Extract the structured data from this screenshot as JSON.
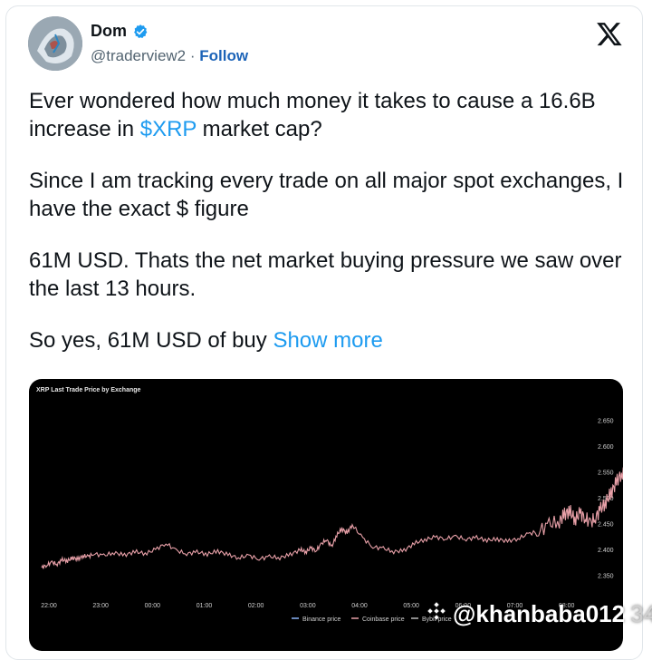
{
  "author": {
    "name": "Dom",
    "handle": "@traderview2",
    "separator": "·",
    "follow_label": "Follow",
    "verified_color": "#1d9bf0"
  },
  "x_logo": "x-logo",
  "tweet": {
    "p1_before": "Ever wondered how much money it takes to cause a 16.6B increase in ",
    "cashtag": "$XRP",
    "p1_after": " market cap?",
    "p2": "Since I am tracking every trade on all major spot exchanges, I have the exact $ figure",
    "p3": "61M USD. Thats the net market buying pressure we saw over the last 13 hours.",
    "p4": "So yes, 61M USD of buy ",
    "show_more": "Show more"
  },
  "watermark": {
    "text": "@khanbaba012",
    "suffix": "34"
  },
  "chart_data": {
    "type": "line",
    "title": "XRP Last Trade Price by Exchange",
    "x_ticks": [
      "22:00",
      "23:00",
      "00:00",
      "01:00",
      "02:00",
      "03:00",
      "04:00",
      "05:00",
      "06:00",
      "07:00",
      "08:00"
    ],
    "y_ticks": [
      "2.350",
      "2.400",
      "2.450",
      "2.500",
      "2.550",
      "2.600",
      "2.650"
    ],
    "ylim": [
      2.33,
      2.66
    ],
    "legend": [
      "Binance price",
      "Coinbase price",
      "Bybit price"
    ],
    "legend_position": "bottom",
    "line_color": "#e8a0a8",
    "series": [
      {
        "name": "Coinbase price",
        "x": [
          0,
          0.1,
          0.2,
          0.3,
          0.4,
          0.5,
          0.6,
          0.7,
          0.8,
          0.9,
          1.0,
          1.2,
          1.4,
          1.6,
          1.8,
          2.0,
          2.2,
          2.4,
          2.6,
          2.8,
          3.0,
          3.2,
          3.4,
          3.6,
          3.8,
          4.0,
          4.2,
          4.4,
          4.6,
          4.8,
          5.0,
          5.1,
          5.2,
          5.3,
          5.4,
          5.5,
          5.6,
          5.7,
          5.8,
          5.9,
          6.0,
          6.2,
          6.4,
          6.6,
          6.8,
          7.0,
          7.2,
          7.4,
          7.6,
          7.8,
          8.0,
          8.2,
          8.4,
          8.6,
          8.8,
          9.0,
          9.2,
          9.4,
          9.6,
          9.8,
          10.0,
          10.1,
          10.2,
          10.3,
          10.4,
          10.5,
          10.6,
          10.7,
          10.8,
          10.9,
          11.0,
          11.1,
          11.2,
          11.3,
          11.4,
          11.5,
          11.55,
          11.6
        ],
        "values": [
          2.365,
          2.37,
          2.375,
          2.372,
          2.38,
          2.378,
          2.384,
          2.381,
          2.388,
          2.386,
          2.392,
          2.388,
          2.394,
          2.389,
          2.396,
          2.392,
          2.4,
          2.412,
          2.398,
          2.392,
          2.395,
          2.391,
          2.397,
          2.39,
          2.384,
          2.388,
          2.382,
          2.386,
          2.384,
          2.39,
          2.4,
          2.395,
          2.403,
          2.398,
          2.41,
          2.42,
          2.405,
          2.428,
          2.44,
          2.432,
          2.448,
          2.422,
          2.405,
          2.402,
          2.396,
          2.398,
          2.412,
          2.419,
          2.424,
          2.421,
          2.425,
          2.42,
          2.423,
          2.418,
          2.42,
          2.416,
          2.421,
          2.43,
          2.436,
          2.448,
          2.455,
          2.468,
          2.475,
          2.458,
          2.47,
          2.462,
          2.45,
          2.463,
          2.478,
          2.492,
          2.51,
          2.53,
          2.548,
          2.54,
          2.56,
          2.575,
          2.585,
          2.6
        ]
      }
    ]
  }
}
